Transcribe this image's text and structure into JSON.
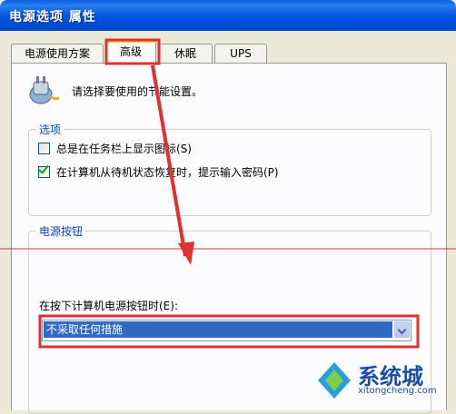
{
  "window": {
    "title": "电源选项 属性"
  },
  "tabs": [
    {
      "label": "电源使用方案"
    },
    {
      "label": "高级"
    },
    {
      "label": "休眠"
    },
    {
      "label": "UPS"
    }
  ],
  "intro": {
    "text": "请选择要使用的节能设置。"
  },
  "options": {
    "legend": "选项",
    "show_icon": {
      "label": "总是在任务栏上显示图标(S)",
      "checked": false
    },
    "prompt_password": {
      "label": "在计算机从待机状态恢复时，提示输入密码(P)",
      "checked": true
    }
  },
  "power_buttons": {
    "legend": "电源按钮",
    "label": "在按下计算机电源按钮时(E):",
    "selected": "不采取任何措施"
  },
  "watermark": {
    "brand": "系统城",
    "url": "xitongcheng.com"
  },
  "colors": {
    "annotation": "#e03030",
    "titlebar": "#0054e3",
    "legend": "#0046d5"
  }
}
